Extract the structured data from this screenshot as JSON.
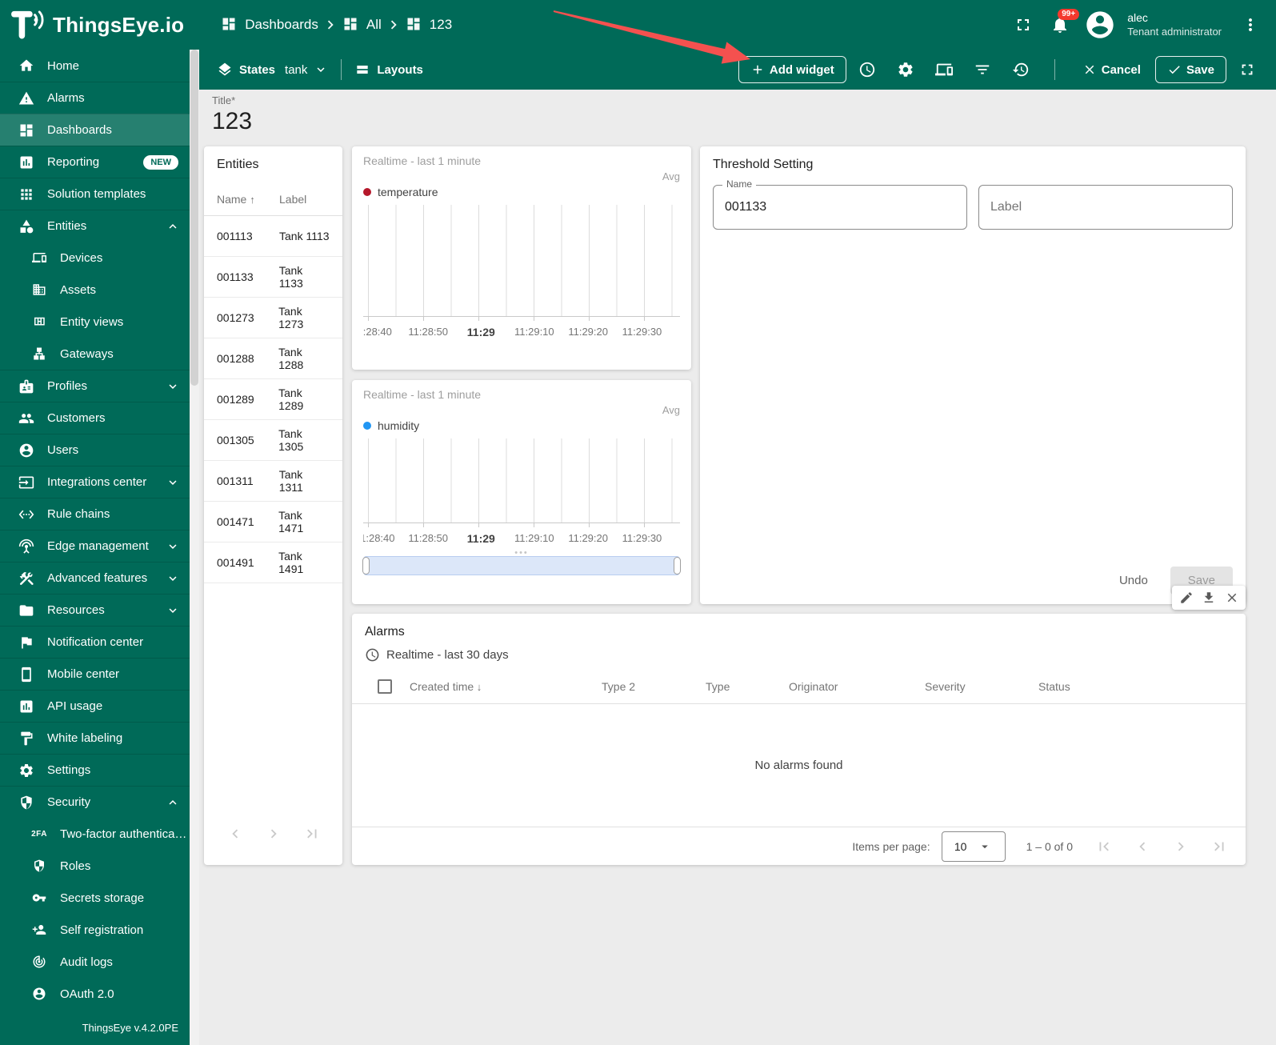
{
  "app": {
    "name": "ThingsEye.io",
    "version": "ThingsEye v.4.2.0PE"
  },
  "header": {
    "breadcrumb": [
      {
        "label": "Dashboards"
      },
      {
        "label": "All"
      },
      {
        "label": "123"
      }
    ],
    "notification_badge": "99+",
    "user": {
      "name": "alec",
      "role": "Tenant administrator"
    }
  },
  "toolbar": {
    "states": {
      "label": "States",
      "value": "tank"
    },
    "layouts_label": "Layouts",
    "add_widget_label": "Add widget",
    "cancel_label": "Cancel",
    "save_label": "Save"
  },
  "dashboard": {
    "title_label": "Title*",
    "title_value": "123"
  },
  "sidebar": {
    "items": [
      {
        "icon": "home",
        "label": "Home"
      },
      {
        "icon": "warning",
        "label": "Alarms"
      },
      {
        "icon": "dashboard",
        "label": "Dashboards",
        "selected": true
      },
      {
        "icon": "chart-box",
        "label": "Reporting",
        "badge": "NEW"
      },
      {
        "icon": "apps",
        "label": "Solution templates"
      },
      {
        "icon": "category",
        "label": "Entities",
        "expandable": true,
        "expanded": true
      },
      {
        "icon": "devices",
        "label": "Devices",
        "indent": true
      },
      {
        "icon": "domain",
        "label": "Assets",
        "indent": true
      },
      {
        "icon": "view-quilt",
        "label": "Entity views",
        "indent": true
      },
      {
        "icon": "lan",
        "label": "Gateways",
        "indent": true
      },
      {
        "icon": "badge-card",
        "label": "Profiles",
        "expandable": true
      },
      {
        "icon": "group",
        "label": "Customers"
      },
      {
        "icon": "account",
        "label": "Users"
      },
      {
        "icon": "input",
        "label": "Integrations center",
        "expandable": true
      },
      {
        "icon": "ethernet",
        "label": "Rule chains"
      },
      {
        "icon": "antenna",
        "label": "Edge management",
        "expandable": true
      },
      {
        "icon": "construction",
        "label": "Advanced features",
        "expandable": true
      },
      {
        "icon": "folder",
        "label": "Resources",
        "expandable": true
      },
      {
        "icon": "flag",
        "label": "Notification center"
      },
      {
        "icon": "smartphone",
        "label": "Mobile center"
      },
      {
        "icon": "chart-box",
        "label": "API usage"
      },
      {
        "icon": "paint",
        "label": "White labeling"
      },
      {
        "icon": "gear",
        "label": "Settings"
      },
      {
        "icon": "shield",
        "label": "Security",
        "expandable": true,
        "expanded": true
      },
      {
        "icon": "2fa",
        "label": "Two-factor authenticati…",
        "indent": true
      },
      {
        "icon": "shield",
        "label": "Roles",
        "indent": true
      },
      {
        "icon": "key",
        "label": "Secrets storage",
        "indent": true
      },
      {
        "icon": "person-add",
        "label": "Self registration",
        "indent": true
      },
      {
        "icon": "track",
        "label": "Audit logs",
        "indent": true
      },
      {
        "icon": "account",
        "label": "OAuth 2.0",
        "indent": true
      }
    ]
  },
  "widgets": {
    "entities": {
      "title": "Entities",
      "columns": [
        {
          "label": "Name",
          "sort": "asc"
        },
        {
          "label": "Label"
        }
      ],
      "rows": [
        {
          "name": "001113",
          "label": "Tank 1113"
        },
        {
          "name": "001133",
          "label": "Tank 1133"
        },
        {
          "name": "001273",
          "label": "Tank 1273"
        },
        {
          "name": "001288",
          "label": "Tank 1288"
        },
        {
          "name": "001289",
          "label": "Tank 1289"
        },
        {
          "name": "001305",
          "label": "Tank 1305"
        },
        {
          "name": "001311",
          "label": "Tank 1311"
        },
        {
          "name": "001471",
          "label": "Tank 1471"
        },
        {
          "name": "001491",
          "label": "Tank 1491"
        }
      ]
    },
    "temperature_chart": {
      "timewindow": "Realtime - last 1 minute",
      "aggregation": "Avg",
      "legend": "temperature",
      "color": "#b5182b"
    },
    "humidity_chart": {
      "timewindow": "Realtime - last 1 minute",
      "aggregation": "Avg",
      "legend": "humidity",
      "color": "#2196f3"
    },
    "threshold": {
      "title": "Threshold Setting",
      "name_field": {
        "label": "Name",
        "value": "001133"
      },
      "label_field": {
        "placeholder": "Label"
      },
      "undo_label": "Undo",
      "save_label": "Save"
    },
    "alarms": {
      "title": "Alarms",
      "timewindow": "Realtime - last 30 days",
      "columns": [
        "Created time",
        "Type 2",
        "Type",
        "Originator",
        "Severity",
        "Status"
      ],
      "sorted_column": "Created time",
      "sort_direction": "desc",
      "empty_text": "No alarms found",
      "paginator": {
        "items_per_page_label": "Items per page:",
        "items_per_page": "10",
        "range": "1 – 0 of 0"
      }
    }
  },
  "chart_data": [
    {
      "type": "line",
      "title": "temperature (Realtime - last 1 minute)",
      "series": [
        {
          "name": "temperature",
          "color": "#b5182b",
          "x": [],
          "y": []
        }
      ],
      "x_ticks": [
        ":28:40",
        "11:28:50",
        "11:29",
        "11:29:10",
        "11:29:20",
        "11:29:30"
      ],
      "aggregation": "Avg",
      "legend_position": "top-left",
      "grid": "vertical",
      "note": "no data plotted"
    },
    {
      "type": "line",
      "title": "humidity (Realtime - last 1 minute)",
      "series": [
        {
          "name": "humidity",
          "color": "#2196f3",
          "x": [],
          "y": []
        }
      ],
      "x_ticks": [
        "1:28:40",
        "11:28:50",
        "11:29",
        "11:29:10",
        "11:29:20",
        "11:29:30"
      ],
      "aggregation": "Avg",
      "legend_position": "top-left",
      "grid": "vertical",
      "has_range_brush": true,
      "note": "no data plotted"
    }
  ]
}
